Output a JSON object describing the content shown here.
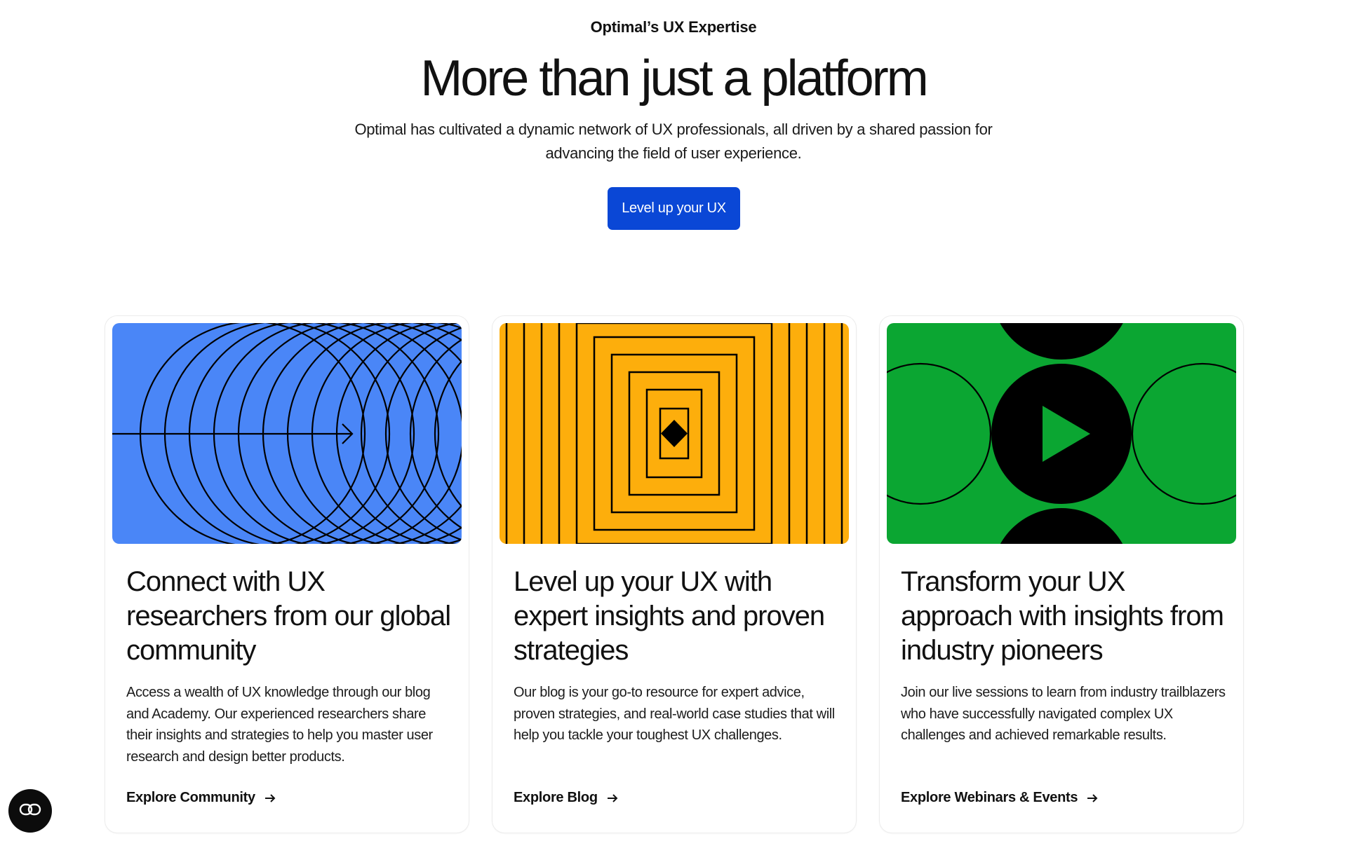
{
  "hero": {
    "eyebrow": "Optimal’s UX Expertise",
    "headline": "More than just a platform",
    "subtitle": "Optimal has cultivated a dynamic network of UX professionals, all driven by a shared passion for advancing the field of user experience.",
    "cta_label": "Level up your UX"
  },
  "cards": [
    {
      "title": "Connect with UX researchers from our global community",
      "body": "Access a wealth of UX knowledge through our blog and Academy. Our experienced researchers share their insights and strategies to help you master user research and design better products.",
      "link": "Explore Community",
      "art_color": "#4a86f7",
      "icon": "concentric-circles-arrow-icon"
    },
    {
      "title": "Level up your UX with expert insights and proven strategies",
      "body": "Our blog is your go-to resource for expert advice, proven strategies, and real-world case studies that will help you tackle your toughest UX challenges.",
      "link": "Explore Blog",
      "art_color": "#fdae0c",
      "icon": "nested-squares-diamond-icon"
    },
    {
      "title": "Transform your UX approach with insights from industry pioneers",
      "body": "Join our live sessions to learn from industry trailblazers who have successfully navigated complex UX challenges and achieved remarkable results.",
      "link": "Explore Webinars & Events",
      "art_color": "#0ba632",
      "icon": "play-circle-icon"
    }
  ],
  "widget": {
    "icon": "accessibility-toggle-icon"
  },
  "colors": {
    "cta": "#0a47d6",
    "text": "#111111"
  }
}
